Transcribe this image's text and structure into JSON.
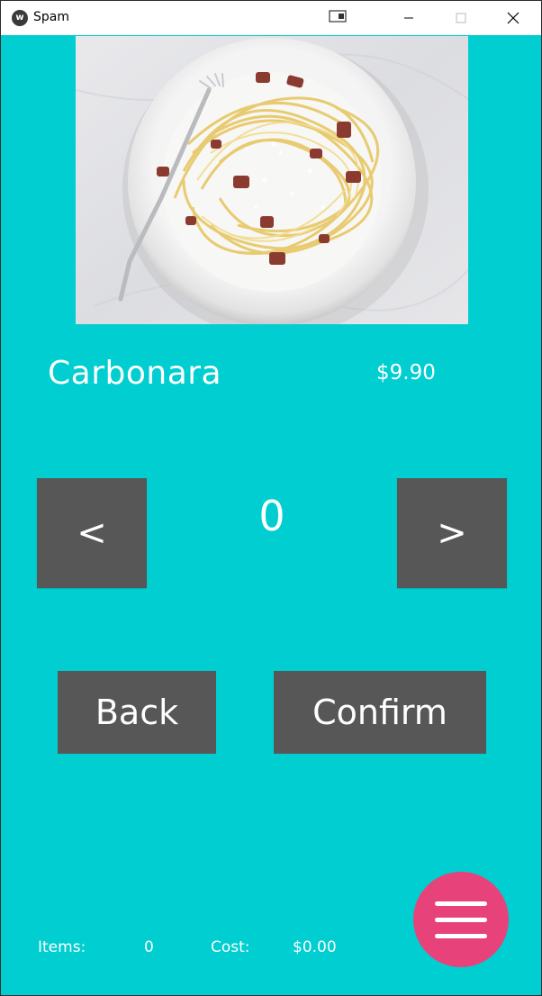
{
  "window": {
    "title": "Spam",
    "app_icon_glyph": "w",
    "controls": {
      "minimize": "minimize-icon",
      "maximize": "maximize-icon",
      "close": "close-icon"
    }
  },
  "item": {
    "name": "Carbonara",
    "price": "$9.90",
    "image_subject": "plate of spaghetti carbonara with fork"
  },
  "quantity": {
    "value": "0",
    "decrement_label": "<",
    "increment_label": ">"
  },
  "actions": {
    "back_label": "Back",
    "confirm_label": "Confirm"
  },
  "footer": {
    "items_label": "Items:",
    "items_value": "0",
    "cost_label": "Cost:",
    "cost_value": "$0.00"
  },
  "menu_button": {
    "icon": "hamburger-menu-icon"
  },
  "colors": {
    "background": "#00ced1",
    "button": "#575757",
    "fab": "#e8427a",
    "text": "#ffffff"
  }
}
